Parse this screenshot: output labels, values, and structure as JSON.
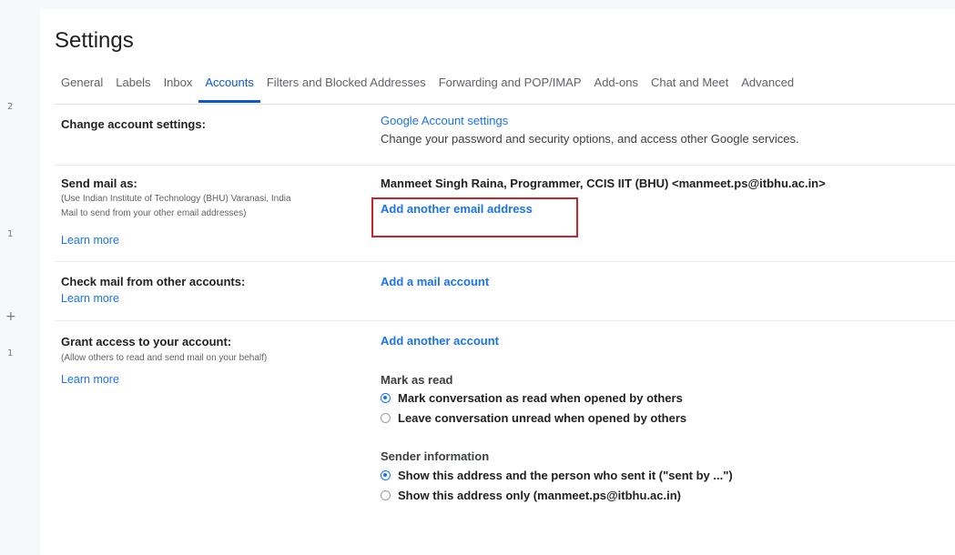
{
  "page_title": "Settings",
  "tabs": [
    {
      "label": "General"
    },
    {
      "label": "Labels"
    },
    {
      "label": "Inbox"
    },
    {
      "label": "Accounts"
    },
    {
      "label": "Filters and Blocked Addresses"
    },
    {
      "label": "Forwarding and POP/IMAP"
    },
    {
      "label": "Add-ons"
    },
    {
      "label": "Chat and Meet"
    },
    {
      "label": "Advanced"
    }
  ],
  "active_tab": "Accounts",
  "left_rail_marks": [
    "2",
    "1",
    "+",
    "1"
  ],
  "change_account": {
    "label": "Change account settings:",
    "link": "Google Account settings",
    "description": "Change your password and security options, and access other Google services."
  },
  "send_mail": {
    "label": "Send mail as:",
    "sub_line1": "(Use Indian Institute of Technology (BHU) Varanasi, India",
    "sub_line2": "Mail to send from your other email addresses)",
    "learn_more": "Learn more",
    "address": "Manmeet Singh Raina, Programmer, CCIS IIT (BHU) <manmeet.ps@itbhu.ac.in>",
    "add_link": "Add another email address"
  },
  "check_mail": {
    "label": "Check mail from other accounts:",
    "learn_more": "Learn more",
    "add_link": "Add a mail account"
  },
  "grant_access": {
    "label": "Grant access to your account:",
    "sub": "(Allow others to read and send mail on your behalf)",
    "learn_more": "Learn more",
    "add_link": "Add another account",
    "mark_as_read_heading": "Mark as read",
    "mark_option1": "Mark conversation as read when opened by others",
    "mark_option2": "Leave conversation unread when opened by others",
    "mark_selected": 1,
    "sender_info_heading": "Sender information",
    "sender_option1": "Show this address and the person who sent it (\"sent by ...\")",
    "sender_option2": "Show this address only (manmeet.ps@itbhu.ac.in)",
    "sender_selected": 1
  },
  "colors": {
    "link": "#1a73e8",
    "active_tab": "#0b57d0",
    "highlight_box": "#c5252d"
  }
}
